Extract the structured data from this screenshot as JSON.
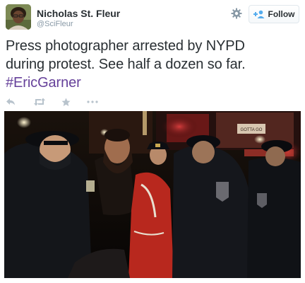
{
  "user": {
    "name": "Nicholas St. Fleur",
    "handle": "@SciFleur"
  },
  "follow_button": {
    "label": "Follow"
  },
  "tweet": {
    "text_line1": "Press photographer arrested by NYPD",
    "text_line2": "during protest. See half a dozen so far.",
    "hashtag": "#EricGarner"
  },
  "actions": {
    "icons": [
      "reply-icon",
      "retweet-icon",
      "favorite-icon",
      "more-icon"
    ]
  },
  "media": {
    "description_icon": "photo",
    "sign_text": "GOTTA GO"
  },
  "colors": {
    "hashtag": "#66419a",
    "text": "#292f33",
    "secondary": "#8899a6",
    "follow_icon": "#55acee"
  }
}
